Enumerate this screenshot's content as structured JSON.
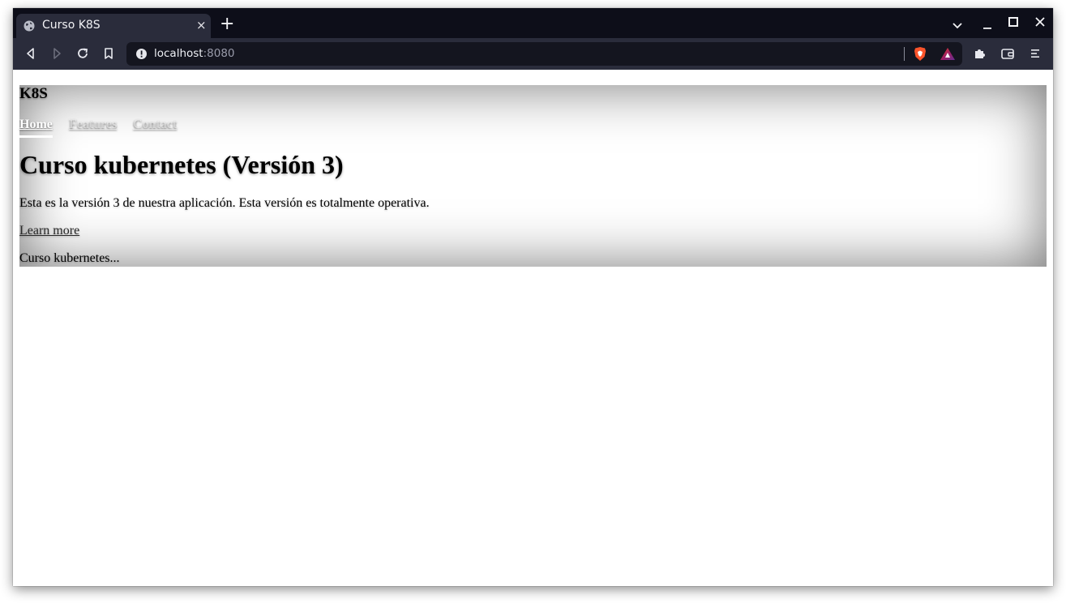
{
  "browser": {
    "tab": {
      "title": "Curso K8S",
      "close_glyph": "×",
      "favicon": "globe-icon"
    },
    "new_tab_glyph": "+",
    "window_controls": {
      "tab_search": "⌄",
      "minimize": "–",
      "maximize": "□",
      "close": "✕"
    },
    "address": {
      "host": "localhost",
      "port": ":8080",
      "security_icon": "info-icon"
    },
    "toolbar_icons": [
      "back-icon",
      "forward-icon",
      "reload-icon",
      "bookmark-icon",
      "brave-shields-icon",
      "brave-rewards-icon",
      "extensions-icon",
      "wallet-icon",
      "menu-icon"
    ]
  },
  "page": {
    "brand": "K8S",
    "nav": [
      {
        "label": "Home",
        "active": true
      },
      {
        "label": "Features",
        "active": false
      },
      {
        "label": "Contact",
        "active": false
      }
    ],
    "headline": "Curso kubernetes (Versión 3)",
    "lead": "Esta es la versión 3 de nuestra aplicación. Esta versión es totalmente operativa.",
    "cta": "Learn more",
    "footer": "Curso kubernetes..."
  },
  "colors": {
    "titlebar": "#0d0e19",
    "toolbar": "#2a2c3b",
    "urlbar": "#14151f",
    "brave_orange": "#fb542b"
  }
}
